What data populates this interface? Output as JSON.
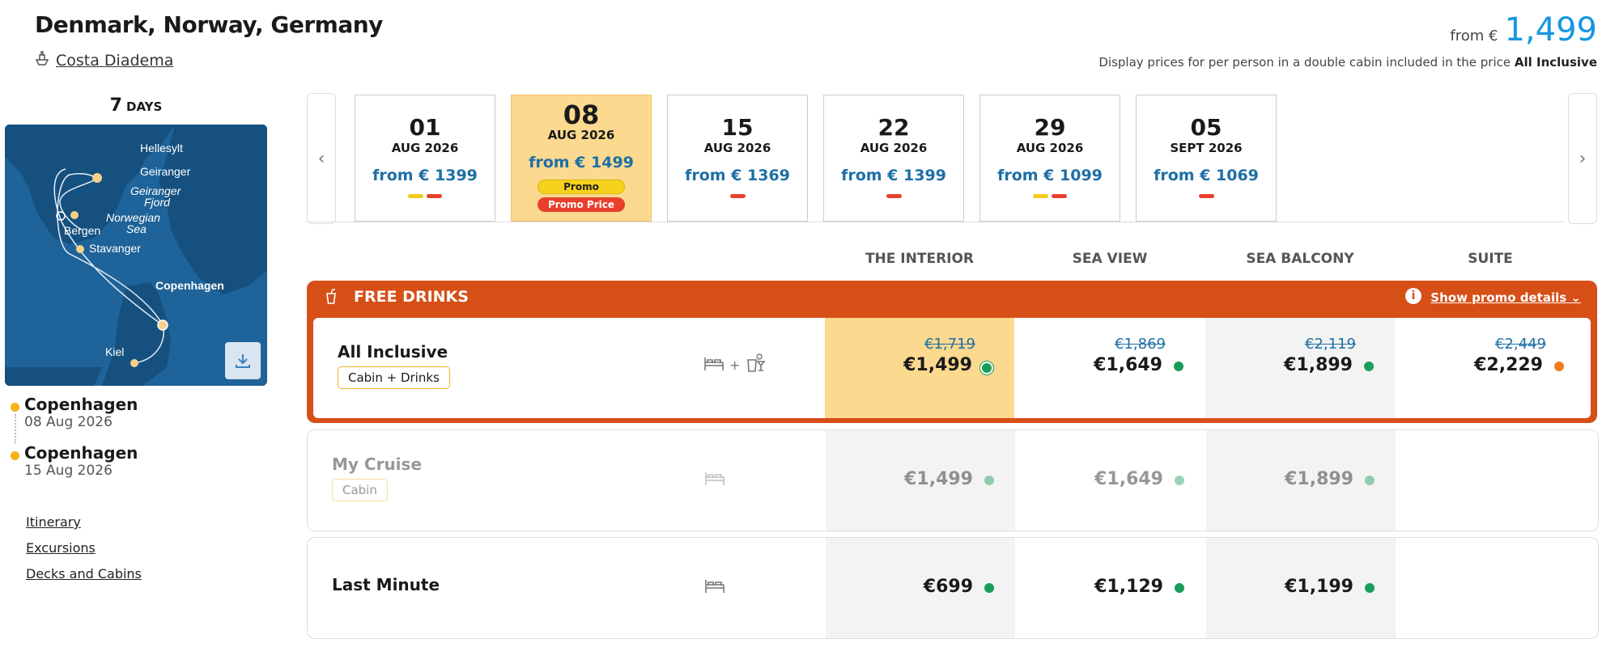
{
  "header": {
    "title": "Denmark, Norway, Germany",
    "ship": "Costa Diadema",
    "price_from": "from €",
    "price_big": "1,499",
    "note_text": "Display prices for per person in a double cabin included in the price",
    "note_bold": "All Inclusive"
  },
  "trip": {
    "days_num": "7",
    "days_unit": "DAYS",
    "map_labels": [
      "Hellesylt",
      "Geiranger",
      "Geiranger",
      "Fjord",
      "Norwegian",
      "Sea",
      "Bergen",
      "Stavanger",
      "Copenhagen",
      "Kiel"
    ],
    "stops": [
      {
        "city": "Copenhagen",
        "date": "08 Aug 2026"
      },
      {
        "city": "Copenhagen",
        "date": "15 Aug 2026"
      }
    ],
    "links": [
      "Itinerary",
      "Excursions",
      "Decks and Cabins"
    ]
  },
  "dates": [
    {
      "day": "01",
      "month": "AUG 2026",
      "from": "from € 1399",
      "bars": [
        "yellow",
        "red"
      ]
    },
    {
      "day": "08",
      "month": "AUG 2026",
      "from": "from € 1499",
      "selected": true,
      "promo": "Promo",
      "promo_price": "Promo Price"
    },
    {
      "day": "15",
      "month": "AUG 2026",
      "from": "from € 1369",
      "bars": [
        "red"
      ]
    },
    {
      "day": "22",
      "month": "AUG 2026",
      "from": "from € 1399",
      "bars": [
        "red"
      ]
    },
    {
      "day": "29",
      "month": "AUG 2026",
      "from": "from € 1099",
      "bars": [
        "yellow",
        "red"
      ]
    },
    {
      "day": "05",
      "month": "SEPT 2026",
      "from": "from € 1069",
      "bars": [
        "red"
      ]
    }
  ],
  "columns": [
    "THE INTERIOR",
    "SEA VIEW",
    "SEA BALCONY",
    "SUITE"
  ],
  "promo": {
    "label": "FREE DRINKS",
    "info": "i",
    "details": "Show promo details"
  },
  "packages": [
    {
      "name": "All Inclusive",
      "tag": "Cabin + Drinks",
      "icons_plus": "+",
      "prices": [
        {
          "old": "€1,719",
          "price": "€1,499",
          "dot": "green"
        },
        {
          "old": "€1,869",
          "price": "€1,649",
          "dot": "green"
        },
        {
          "old": "€2,119",
          "price": "€1,899",
          "dot": "green"
        },
        {
          "old": "€2,449",
          "price": "€2,229",
          "dot": "orange"
        }
      ]
    },
    {
      "name": "My Cruise",
      "tag": "Cabin",
      "prices": [
        {
          "price": "€1,499",
          "dot": "green"
        },
        {
          "price": "€1,649",
          "dot": "green"
        },
        {
          "price": "€1,899",
          "dot": "green"
        }
      ]
    },
    {
      "name": "Last Minute",
      "prices": [
        {
          "price": "€699",
          "dot": "green"
        },
        {
          "price": "€1,129",
          "dot": "green"
        },
        {
          "price": "€1,199",
          "dot": "green"
        }
      ]
    }
  ],
  "colors": {
    "accent_blue": "#1696e2",
    "promo_orange": "#d64f17",
    "highlight_yellow": "#fbd98f",
    "available_green": "#1a9d5a",
    "limited_orange": "#f07c1c"
  }
}
